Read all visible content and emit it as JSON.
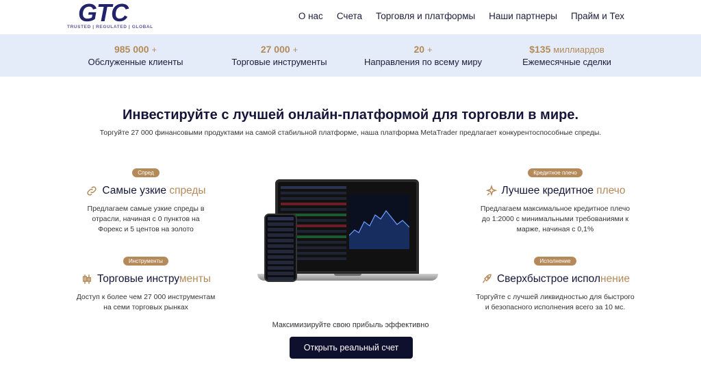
{
  "header": {
    "logo_text": "GTC",
    "logo_tagline": "TRUSTED | REGULATED | GLOBAL",
    "nav": [
      {
        "label": "О нас"
      },
      {
        "label": "Счета"
      },
      {
        "label": "Торговля и платформы"
      },
      {
        "label": "Наши партнеры"
      },
      {
        "label": "Прайм и Тех"
      }
    ]
  },
  "stats": [
    {
      "value": "985 000",
      "suffix": "+",
      "label": "Обслуженные клиенты"
    },
    {
      "value": "27 000",
      "suffix": "+",
      "label": "Торговые инструменты"
    },
    {
      "value": "20",
      "suffix": "+",
      "label": "Направления по всему миру"
    },
    {
      "value": "$135",
      "suffix": "миллиардов",
      "label": "Ежемесячные сделки"
    }
  ],
  "main": {
    "headline": "Инвестируйте с лучшей онлайн-платформой для торговли в мире.",
    "subline": "Торгуйте 27 000 финансовыми продуктами на самой стабильной платформе, наша платформа MetaTrader предлагает конкурентоспособные спреды.",
    "cta_text": "Максимизируйте свою прибыль эффективно",
    "cta_button": "Открыть реальный счет"
  },
  "features": {
    "spread": {
      "badge": "Спред",
      "title_main": "Самые узкие ",
      "title_accent": "спреды",
      "desc": "Предлагаем самые узкие спреды в отрасли, начиная с 0 пунктов на Форекс и 5 центов на золото",
      "icon": "link-icon"
    },
    "instruments": {
      "badge": "Инструменты",
      "title_main": "Торговые инстру",
      "title_accent": "менты",
      "desc": "Доступ к более чем 27 000 инструментам на семи торговых рынках",
      "icon": "candlestick-icon"
    },
    "leverage": {
      "badge": "Кредитное плечо",
      "title_main": "Лучшее кредитное ",
      "title_accent": "плечо",
      "desc": "Предлагаем максимальное кредитное плечо до 1:2000 с минимальными требованиями к марже, начиная с 0,1%",
      "icon": "sparkle-icon"
    },
    "execution": {
      "badge": "Исполнение",
      "title_main": "Сверхбыстрое испол",
      "title_accent": "нение",
      "desc": "Торгуйте с лучшей ликвидностью для быстрого и безопасного исполнения всего за 10 мс.",
      "icon": "rocket-icon"
    }
  },
  "colors": {
    "accent": "#b58a5a",
    "navy": "#0f0f2e",
    "stats_bg": "#e3ecf8"
  }
}
